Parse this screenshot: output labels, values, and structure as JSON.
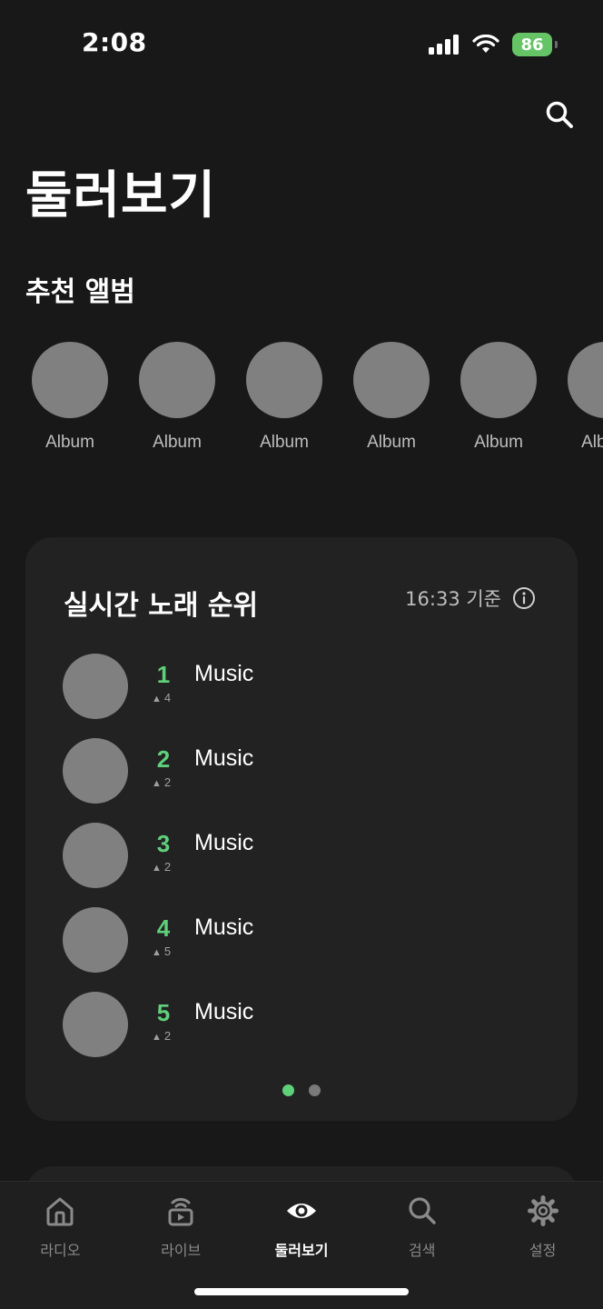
{
  "status_bar": {
    "time": "2:08",
    "battery": "86"
  },
  "page_title": "둘러보기",
  "recommended": {
    "title": "추천 앨범",
    "albums": [
      {
        "label": "Album"
      },
      {
        "label": "Album"
      },
      {
        "label": "Album"
      },
      {
        "label": "Album"
      },
      {
        "label": "Album"
      },
      {
        "label": "Album"
      }
    ]
  },
  "chart": {
    "title": "실시간 노래 순위",
    "updated": "16:33 기준",
    "rows": [
      {
        "rank": "1",
        "change": "4",
        "title": "Music"
      },
      {
        "rank": "2",
        "change": "2",
        "title": "Music"
      },
      {
        "rank": "3",
        "change": "2",
        "title": "Music"
      },
      {
        "rank": "4",
        "change": "5",
        "title": "Music"
      },
      {
        "rank": "5",
        "change": "2",
        "title": "Music"
      }
    ],
    "page_indicator": {
      "total": 2,
      "current": 1
    },
    "accent_color": "#5fd07a"
  },
  "tabbar": {
    "tabs": [
      {
        "label": "라디오",
        "icon": "home-icon"
      },
      {
        "label": "라이브",
        "icon": "live-icon"
      },
      {
        "label": "둘러보기",
        "icon": "eye-icon"
      },
      {
        "label": "검색",
        "icon": "search-icon"
      },
      {
        "label": "설정",
        "icon": "gear-icon"
      }
    ],
    "active_index": 2
  }
}
